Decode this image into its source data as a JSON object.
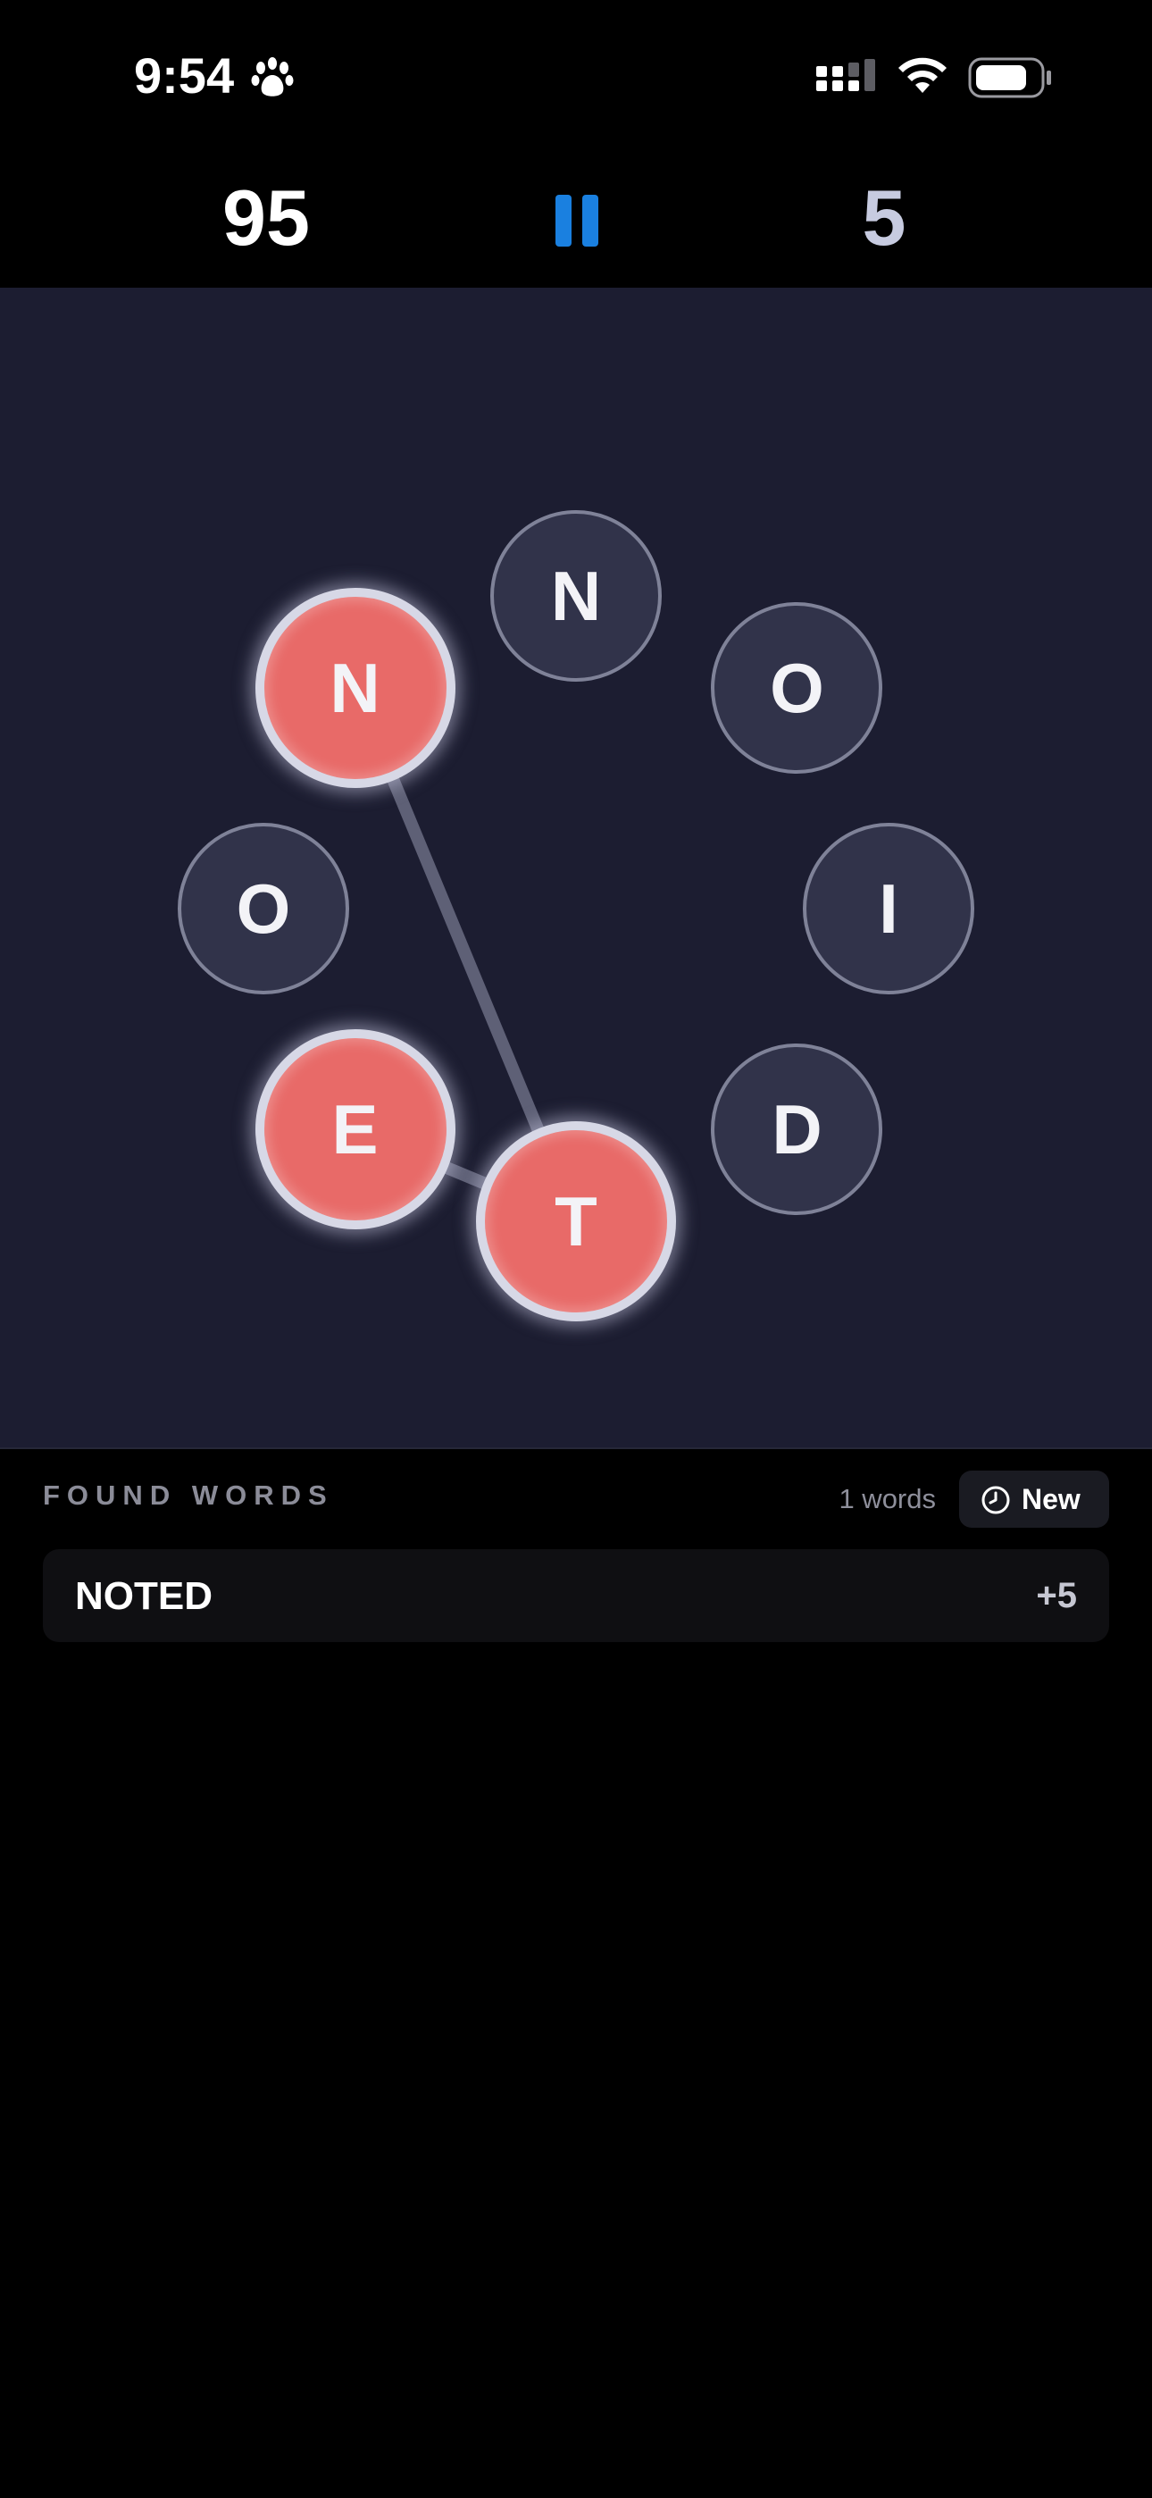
{
  "status_bar": {
    "time": "9:54",
    "icons": [
      "paw-icon",
      "cellular-signal-icon",
      "wifi-icon",
      "battery-icon"
    ]
  },
  "header": {
    "score": "95",
    "moves": "5",
    "pause_icon": "pause-icon"
  },
  "colors": {
    "board_bg": "#1c1d31",
    "tile_bg": "#31334a",
    "tile_selected": "#e86a68",
    "accent_blue": "#1a80e0"
  },
  "board": {
    "tiles": [
      {
        "letter": "N",
        "selected": false
      },
      {
        "letter": "O",
        "selected": false
      },
      {
        "letter": "I",
        "selected": false
      },
      {
        "letter": "D",
        "selected": false
      },
      {
        "letter": "T",
        "selected": true
      },
      {
        "letter": "E",
        "selected": true
      },
      {
        "letter": "O",
        "selected": false
      },
      {
        "letter": "N",
        "selected": true
      }
    ],
    "path_order": [
      "N",
      "T",
      "E"
    ]
  },
  "found_words": {
    "title": "FOUND WORDS",
    "count_label": "1 words",
    "sort_button": "New",
    "sort_icon": "clock-icon",
    "items": [
      {
        "word": "NOTED",
        "points": "+5"
      }
    ]
  }
}
